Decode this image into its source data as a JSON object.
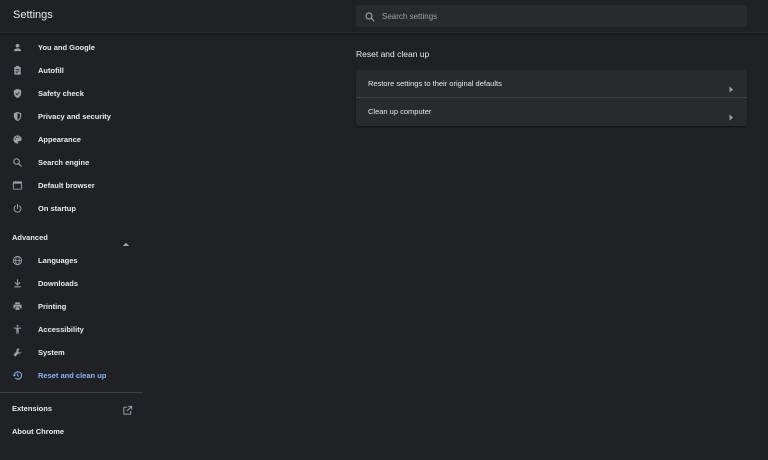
{
  "header": {
    "title": "Settings",
    "search_placeholder": "Search settings"
  },
  "sidebar": {
    "items": [
      {
        "label": "You and Google",
        "icon": "person-icon"
      },
      {
        "label": "Autofill",
        "icon": "clipboard-icon"
      },
      {
        "label": "Safety check",
        "icon": "shield-check-icon"
      },
      {
        "label": "Privacy and security",
        "icon": "shield-lock-icon"
      },
      {
        "label": "Appearance",
        "icon": "palette-icon"
      },
      {
        "label": "Search engine",
        "icon": "search-icon"
      },
      {
        "label": "Default browser",
        "icon": "browser-window-icon"
      },
      {
        "label": "On startup",
        "icon": "power-icon"
      }
    ],
    "advanced": {
      "label": "Advanced",
      "expanded": true,
      "items": [
        {
          "label": "Languages",
          "icon": "globe-icon"
        },
        {
          "label": "Downloads",
          "icon": "download-icon"
        },
        {
          "label": "Printing",
          "icon": "printer-icon"
        },
        {
          "label": "Accessibility",
          "icon": "accessibility-icon"
        },
        {
          "label": "System",
          "icon": "wrench-icon"
        },
        {
          "label": "Reset and clean up",
          "icon": "restore-icon",
          "active": true
        }
      ]
    },
    "extensions_label": "Extensions",
    "about_label": "About Chrome"
  },
  "main": {
    "section_title": "Reset and clean up",
    "rows": [
      {
        "label": "Restore settings to their original defaults"
      },
      {
        "label": "Clean up computer"
      }
    ]
  },
  "colors": {
    "background": "#202124",
    "card": "#292a2d",
    "accent": "#8ab4f8",
    "text": "#e8eaed",
    "icon": "#9aa0a6"
  }
}
